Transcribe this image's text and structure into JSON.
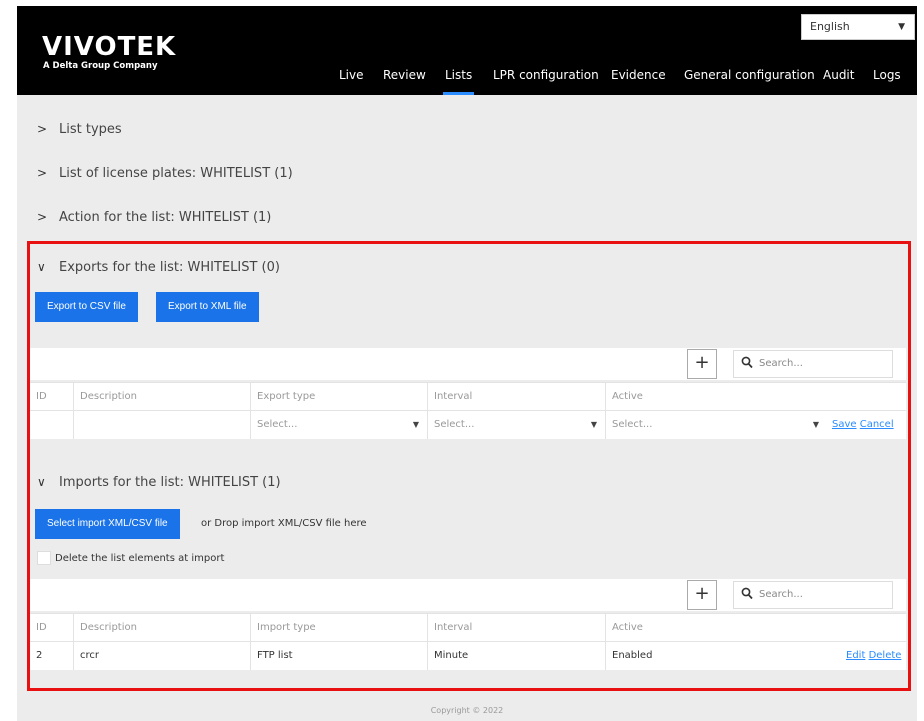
{
  "header": {
    "logo_main": "VIVOTEK",
    "logo_sub": "A Delta Group Company",
    "language": "English",
    "nav": [
      "Live",
      "Review",
      "Lists",
      "LPR configuration",
      "Evidence",
      "General configuration",
      "Audit",
      "Logs"
    ],
    "active_nav": "Lists"
  },
  "sections": {
    "list_types": "List types",
    "license_plates": "List of license plates: WHITELIST (1)",
    "action": "Action for the list: WHITELIST (1)",
    "exports": "Exports for the list: WHITELIST (0)",
    "imports": "Imports for the list: WHITELIST (1)"
  },
  "exports": {
    "csv_button": "Export to CSV file",
    "xml_button": "Export to XML file",
    "search_placeholder": "Search...",
    "columns": [
      "ID",
      "Description",
      "Export type",
      "Interval",
      "Active"
    ],
    "new_row": {
      "export_type": "Select...",
      "interval": "Select...",
      "active": "Select...",
      "save": "Save",
      "cancel": "Cancel"
    }
  },
  "imports": {
    "select_button": "Select import XML/CSV file",
    "drop_text": "or Drop import XML/CSV file here",
    "delete_checkbox": "Delete the list elements at import",
    "search_placeholder": "Search...",
    "columns": [
      "ID",
      "Description",
      "Import type",
      "Interval",
      "Active"
    ],
    "rows": [
      {
        "id": "2",
        "description": "crcr",
        "import_type": "FTP list",
        "interval": "Minute",
        "active": "Enabled",
        "edit": "Edit",
        "delete": "Delete"
      }
    ]
  },
  "footer": {
    "copyright": "Copyright © 2022"
  },
  "colors": {
    "accent": "#1a73e8",
    "header_bg": "#000000",
    "highlight_box": "#e81010",
    "link": "#2a8cff"
  }
}
